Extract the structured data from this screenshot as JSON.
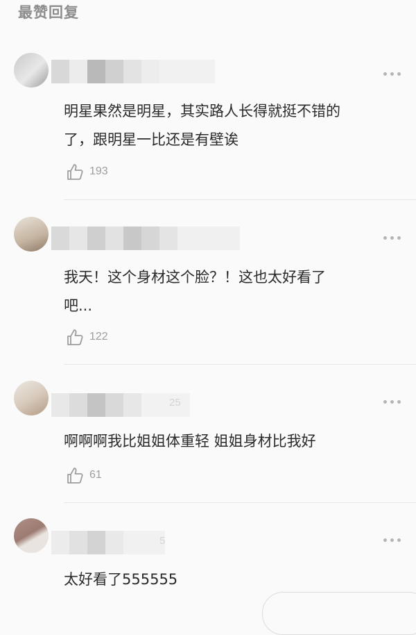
{
  "section_title": "最赞回复",
  "colors": {
    "background": "#fafafa",
    "title_gray": "#8d8d8d",
    "text": "#2a2a2a",
    "meta_gray": "#9d9d9d",
    "divider": "#e6e6e6"
  },
  "icons": {
    "more": "more-dots-icon",
    "like": "thumbs-up-icon"
  },
  "comments": [
    {
      "text_line1": "明星果然是明星，其实路人长得就挺不错的",
      "text_line2": "了，跟明星一比还是有壁诶",
      "likes": "193",
      "ghost": ""
    },
    {
      "text_line1": "我天！这个身材这个脸？！这也太好看了",
      "text_line2": "吧...",
      "likes": "122",
      "ghost": ""
    },
    {
      "text_line1": "啊啊啊我比姐姐体重轻 姐姐身材比我好",
      "text_line2": "",
      "likes": "61",
      "ghost": "25"
    },
    {
      "text_line1": "太好看了555555",
      "text_line2": "",
      "likes": "",
      "ghost": "5"
    }
  ]
}
